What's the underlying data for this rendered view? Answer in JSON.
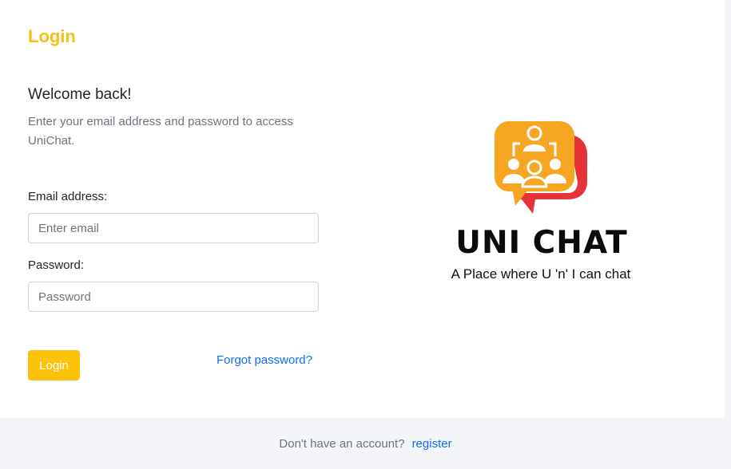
{
  "colors": {
    "accent": "#f8bf12",
    "button": "#fcc209",
    "link": "#0d6efd",
    "logo_orange": "#f6a623",
    "logo_red": "#e6333a"
  },
  "login": {
    "title": "Login",
    "welcome": "Welcome back!",
    "subtitle": "Enter your email address and password to access UniChat.",
    "email_label": "Email address:",
    "email_placeholder": "Enter email",
    "email_value": "",
    "password_label": "Password:",
    "password_placeholder": "Password",
    "password_value": "",
    "login_button": "Login",
    "forgot_password": "Forgot password?"
  },
  "brand": {
    "logo_icon": "group-chat-icon",
    "name": "UNI CHAT",
    "tagline": "A Place where U 'n' I can chat"
  },
  "footer": {
    "prompt": "Don't have an account?",
    "register": "register"
  }
}
